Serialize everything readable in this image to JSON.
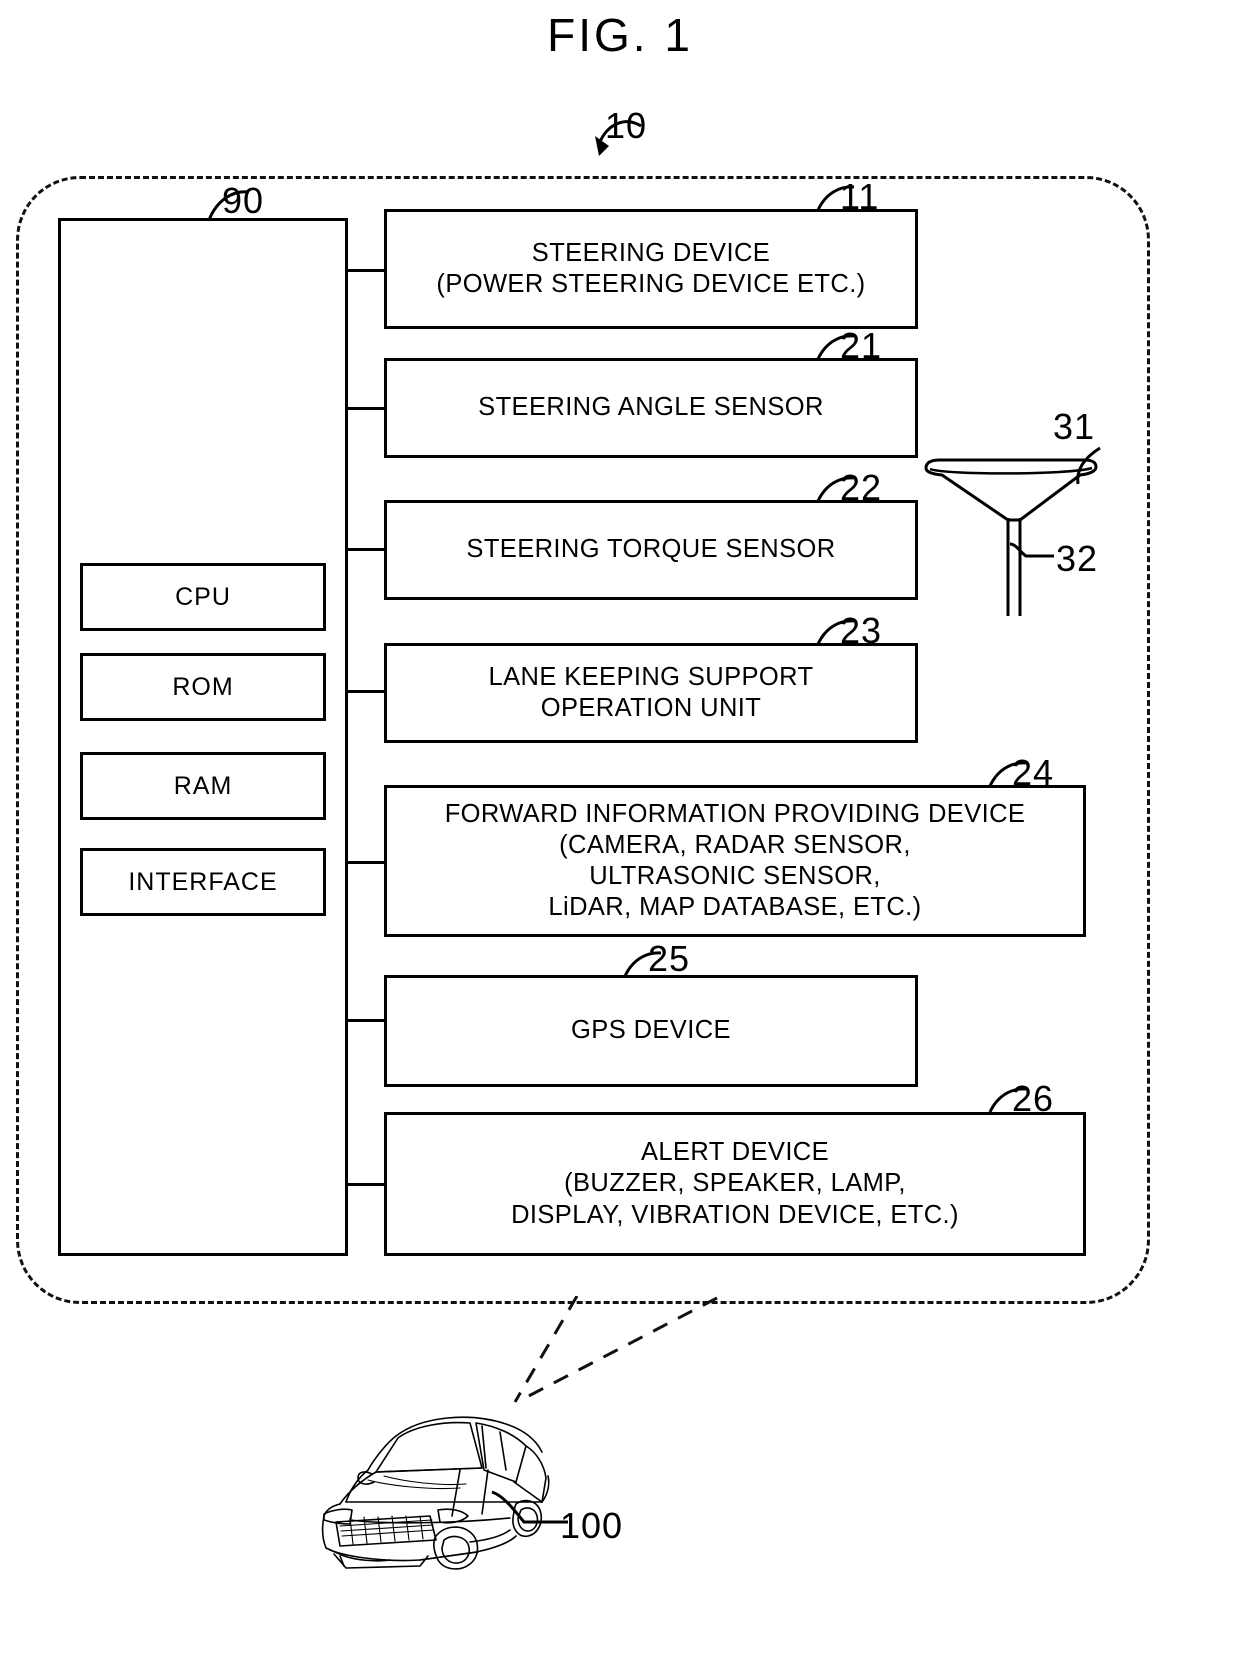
{
  "figure": {
    "title": "FIG. 1",
    "system_ref": "10",
    "vehicle_ref": "100"
  },
  "ecu": {
    "ref": "90",
    "units": [
      {
        "label": "CPU"
      },
      {
        "label": "ROM"
      },
      {
        "label": "RAM"
      },
      {
        "label": "INTERFACE"
      }
    ]
  },
  "devices": [
    {
      "ref": "11",
      "lines": [
        "STEERING DEVICE",
        "(POWER STEERING DEVICE ETC.)"
      ]
    },
    {
      "ref": "21",
      "lines": [
        "STEERING ANGLE SENSOR"
      ]
    },
    {
      "ref": "22",
      "lines": [
        "STEERING TORQUE SENSOR"
      ]
    },
    {
      "ref": "23",
      "lines": [
        "LANE KEEPING SUPPORT",
        "OPERATION UNIT"
      ]
    },
    {
      "ref": "24",
      "lines": [
        "FORWARD INFORMATION PROVIDING DEVICE",
        "(CAMERA, RADAR SENSOR,",
        "ULTRASONIC SENSOR,",
        "LiDAR, MAP DATABASE, ETC.)"
      ]
    },
    {
      "ref": "25",
      "lines": [
        "GPS DEVICE"
      ]
    },
    {
      "ref": "26",
      "lines": [
        "ALERT DEVICE",
        "(BUZZER, SPEAKER, LAMP,",
        "DISPLAY, VIBRATION DEVICE, ETC.)"
      ]
    }
  ],
  "antenna": {
    "dish_ref": "31",
    "mast_ref": "32"
  },
  "colors": {
    "ink": "#000000",
    "paper": "#ffffff"
  }
}
